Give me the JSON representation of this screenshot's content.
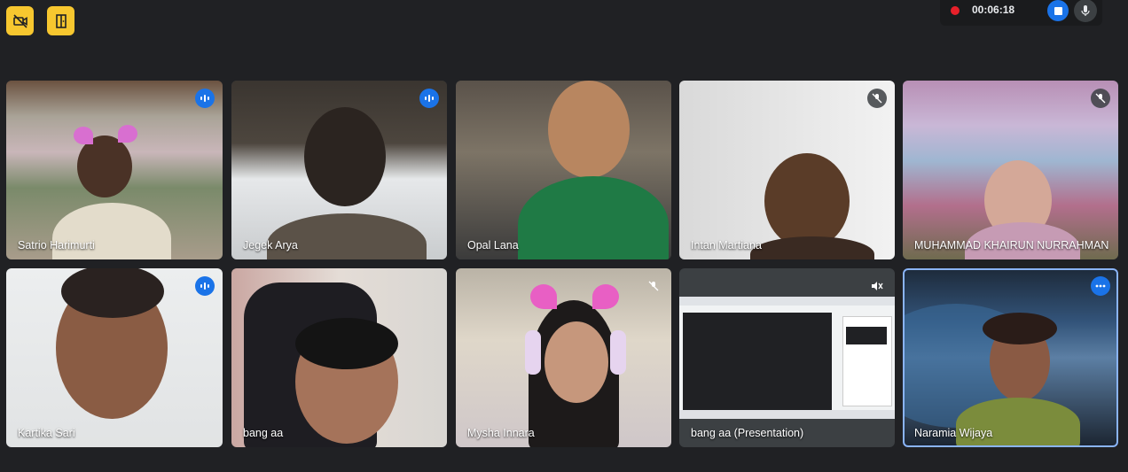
{
  "toolbar": {
    "left_buttons": [
      {
        "icon": "no-video-icon"
      },
      {
        "icon": "door-exit-icon"
      }
    ]
  },
  "recording": {
    "time": "00:06:18",
    "stop_icon": "stop-icon",
    "mic_icon": "mic-icon"
  },
  "participants": [
    {
      "name": "Satrio Harimurti",
      "status": "speaking"
    },
    {
      "name": "Jegek Arya",
      "status": "speaking"
    },
    {
      "name": "Opal Lana",
      "status": "none"
    },
    {
      "name": "Intan Martiana",
      "status": "muted"
    },
    {
      "name": "MUHAMMAD KHAIRUN NURRAHMAN",
      "status": "muted"
    },
    {
      "name": "Kartika Sari",
      "status": "speaking"
    },
    {
      "name": "bang aa",
      "status": "none"
    },
    {
      "name": "Mysha Innara",
      "status": "muted"
    },
    {
      "name": "bang aa (Presentation)",
      "status": "muted-audio"
    },
    {
      "name": "Naramia Wijaya",
      "status": "more-options"
    }
  ],
  "colors": {
    "background": "#202124",
    "accent": "#1a73e8",
    "yellow": "#f7c72f",
    "record": "#e8202a"
  }
}
